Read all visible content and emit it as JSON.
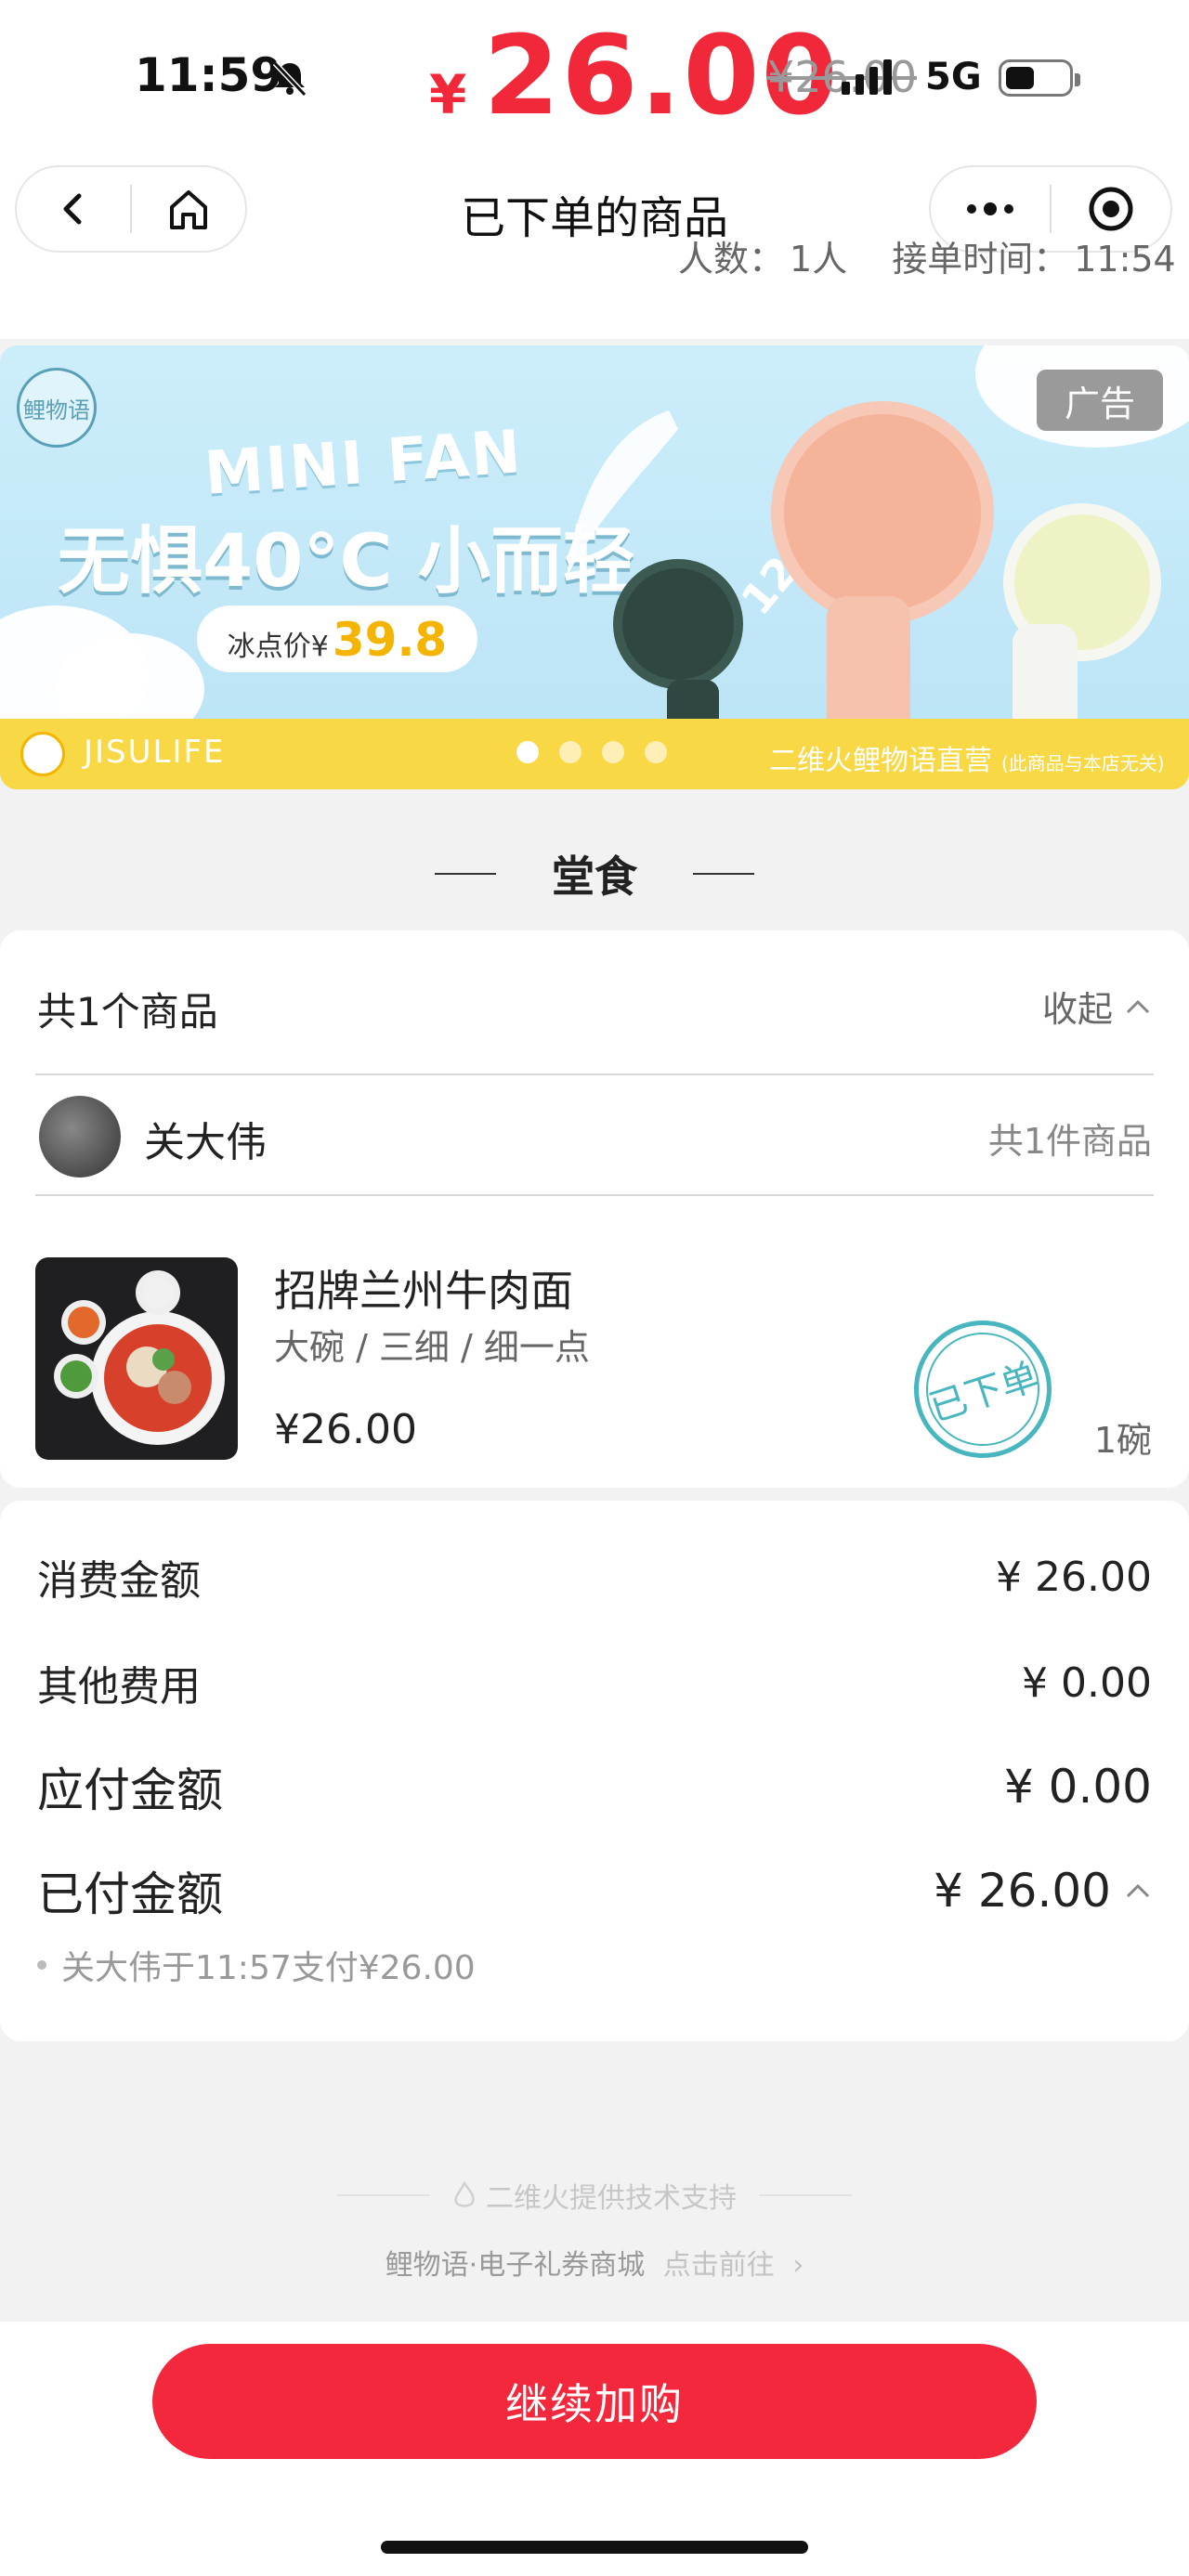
{
  "status_bar": {
    "time": "11:59",
    "network": "5G"
  },
  "price_overlay": {
    "currency": "¥",
    "amount": "26.00",
    "strike": "¥26.00"
  },
  "nav": {
    "title": "已下单的商品"
  },
  "meta": {
    "people_label": "人数：",
    "people_value": "1人",
    "time_label": "接单时间：",
    "time_value": "11:54"
  },
  "banner": {
    "logo_text": "鲤物语",
    "ad_label": "广告",
    "tagline_en": "MINI FAN",
    "headline": "无惧40°C 小而轻",
    "price_label": "冰点价¥",
    "price_value": "39.8",
    "ribbon": "12小时续航~",
    "brand": "JISULIFE",
    "right_text": "二维火鲤物语直营",
    "right_small": "(此商品与本店无关)",
    "dots": 4,
    "active_dot": 0
  },
  "section": {
    "title": "堂食"
  },
  "order": {
    "header": "共1个商品",
    "collapse_label": "收起",
    "user_name": "关大伟",
    "user_count": "共1件商品",
    "item": {
      "name": "招牌兰州牛肉面",
      "spec": "大碗 / 三细 / 细一点",
      "price": "¥26.00",
      "qty": "1碗",
      "stamp": "已下单"
    }
  },
  "summary": {
    "consume_label": "消费金额",
    "consume_value": "¥ 26.00",
    "other_label": "其他费用",
    "other_value": "¥ 0.00",
    "payable_label": "应付金额",
    "payable_value": "¥ 0.00",
    "paid_label": "已付金额",
    "paid_value": "¥ 26.00",
    "pay_note": "关大伟于11:57支付¥26.00"
  },
  "footer": {
    "support": "二维火提供技术支持",
    "link_text": "鲤物语·电子礼券商城",
    "link_action": "点击前往"
  },
  "bottom": {
    "button_label": "继续加购"
  },
  "colors": {
    "accent": "#f4283c",
    "stamp": "#47b6bf",
    "banner_yellow": "#f9d846"
  }
}
